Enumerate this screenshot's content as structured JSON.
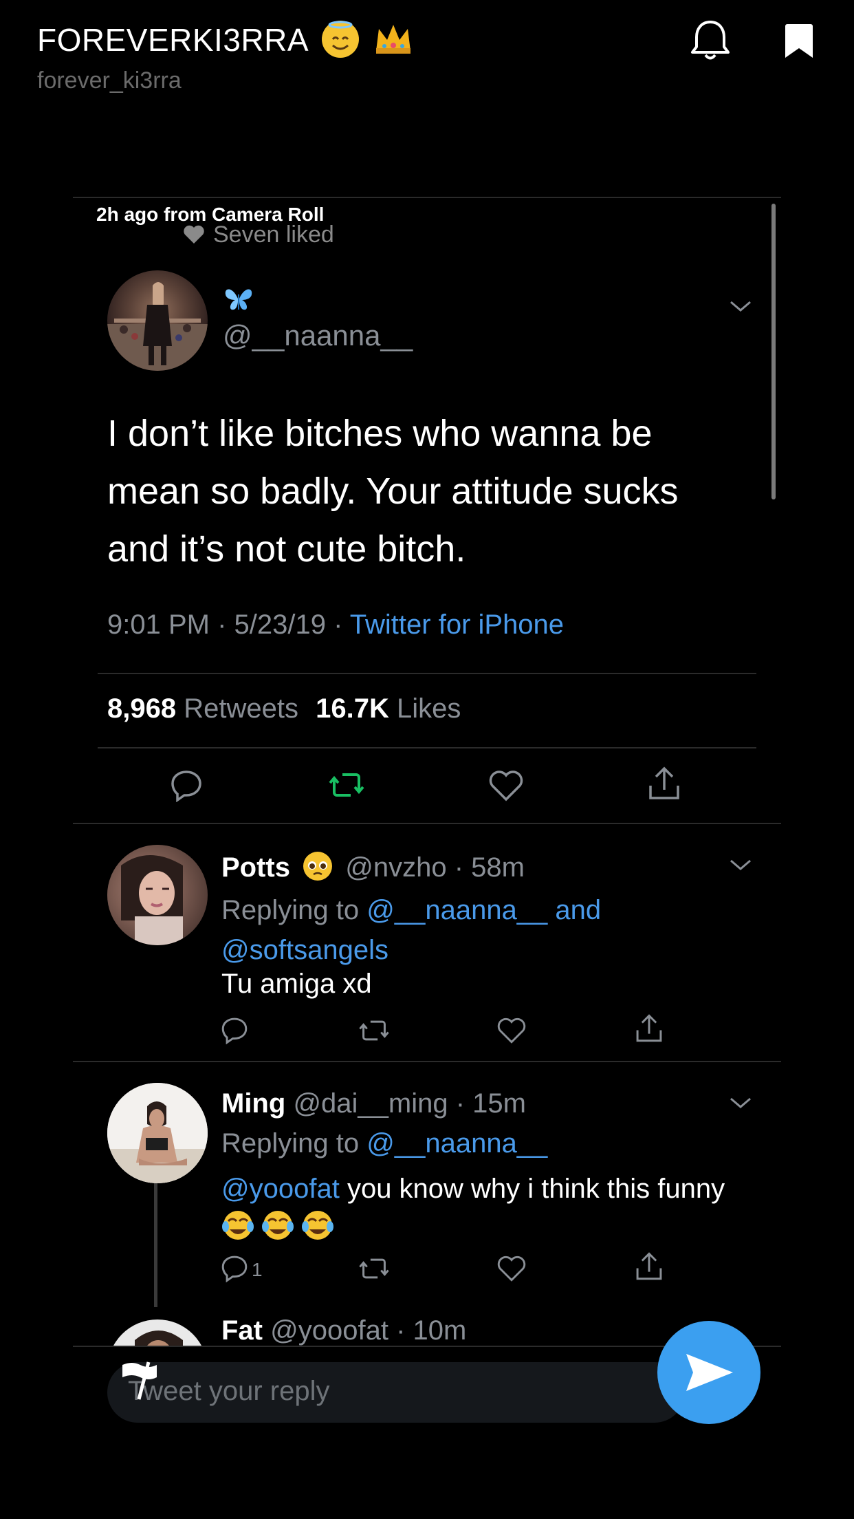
{
  "header": {
    "title": "FOREVERKI3RRA",
    "username": "forever_ki3rra"
  },
  "story": {
    "meta": "2h ago from Camera Roll",
    "liked": "Seven liked"
  },
  "tweet": {
    "display_name": "",
    "handle": "@__naanna__",
    "body": "I don’t like bitches who wanna be mean so badly. Your attitude sucks and it’s not cute bitch.",
    "time": "9:01 PM · 5/23/19 · ",
    "source": "Twitter for iPhone",
    "retweets_count": "8,968",
    "retweets_label": "Retweets",
    "likes_count": "16.7K",
    "likes_label": "Likes"
  },
  "replies": [
    {
      "name": "Potts",
      "handle": "@nvzho",
      "time": "58m",
      "replying_prefix": "Replying to ",
      "replying_to": "@__naanna__ and @softsangels",
      "text": "Tu amiga xd",
      "reply_count": ""
    },
    {
      "name": "Ming",
      "handle": "@dai__ming",
      "time": "15m",
      "replying_prefix": "Replying to ",
      "replying_to": "@__naanna__",
      "mention": "@yooofat",
      "text": " you know why i think this funny",
      "reply_count": "1"
    },
    {
      "name": "Fat",
      "handle": "@yooofat",
      "time": "10m"
    }
  ],
  "reply_bar": {
    "placeholder": "Tweet your reply"
  },
  "colors": {
    "background": "#000000",
    "link": "#4a9aea",
    "retweet_active": "#19bf63",
    "send_button": "#3b9ff0",
    "muted": "#8a8f96"
  },
  "icons": [
    "bell-icon",
    "bookmark-icon",
    "heart-icon",
    "butterfly-icon",
    "chevron-down-icon",
    "reply-icon",
    "retweet-icon",
    "like-icon",
    "share-icon",
    "send-icon",
    "flag-icon"
  ]
}
